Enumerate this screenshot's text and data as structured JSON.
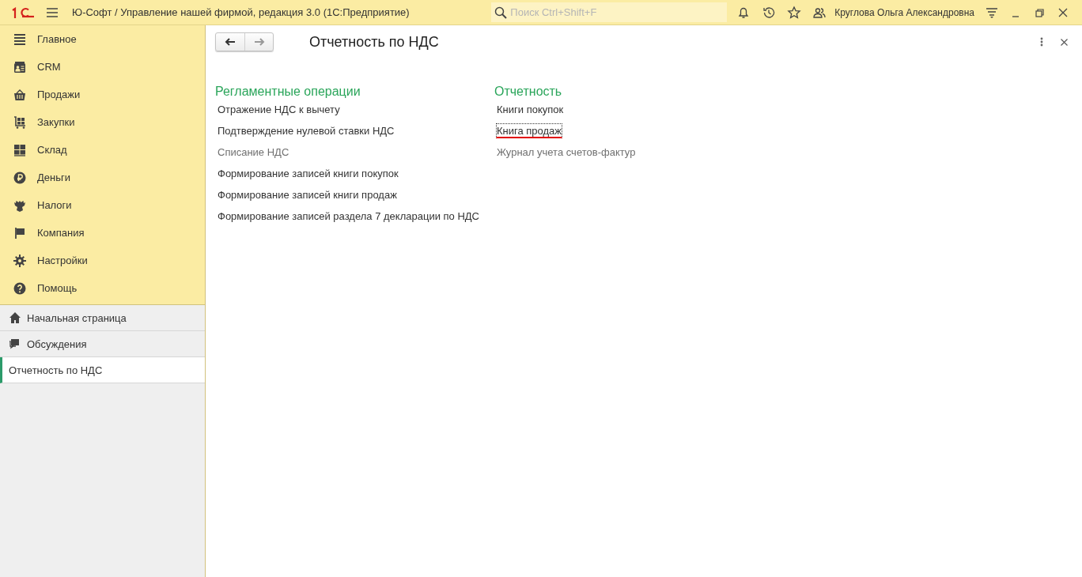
{
  "header": {
    "title": "Ю-Софт / Управление нашей фирмой, редакция 3.0  (1С:Предприятие)",
    "search": {
      "placeholder": "Поиск Ctrl+Shift+F"
    },
    "user": "Круглова Ольга Александровна"
  },
  "sections": [
    {
      "label": "Главное"
    },
    {
      "label": "CRM"
    },
    {
      "label": "Продажи"
    },
    {
      "label": "Закупки"
    },
    {
      "label": "Склад"
    },
    {
      "label": "Деньги"
    },
    {
      "label": "Налоги"
    },
    {
      "label": "Компания"
    },
    {
      "label": "Настройки"
    },
    {
      "label": "Помощь"
    }
  ],
  "open_windows": [
    {
      "label": "Начальная страница",
      "selected": false
    },
    {
      "label": "Обсуждения",
      "selected": false
    },
    {
      "label": "Отчетность по НДС",
      "selected": true
    }
  ],
  "form": {
    "title": "Отчетность по НДС",
    "groups": [
      {
        "title": "Регламентные операции",
        "links": [
          {
            "label": "Отражение НДС к вычету",
            "visited": false,
            "focused": false,
            "underlined": false
          },
          {
            "label": "Подтверждение нулевой ставки НДС",
            "visited": false,
            "focused": false,
            "underlined": false
          },
          {
            "label": "Списание НДС",
            "visited": true,
            "focused": false,
            "underlined": false
          },
          {
            "label": "Формирование записей книги покупок",
            "visited": false,
            "focused": false,
            "underlined": false
          },
          {
            "label": "Формирование записей книги продаж",
            "visited": false,
            "focused": false,
            "underlined": false
          },
          {
            "label": "Формирование записей раздела 7 декларации по НДС",
            "visited": false,
            "focused": false,
            "underlined": false
          }
        ]
      },
      {
        "title": "Отчетность",
        "links": [
          {
            "label": "Книги покупок",
            "visited": false,
            "focused": false,
            "underlined": false
          },
          {
            "label": "Книга продаж",
            "visited": false,
            "focused": true,
            "underlined": true
          },
          {
            "label": "Журнал учета счетов-фактур",
            "visited": true,
            "focused": false,
            "underlined": false
          }
        ]
      }
    ]
  }
}
